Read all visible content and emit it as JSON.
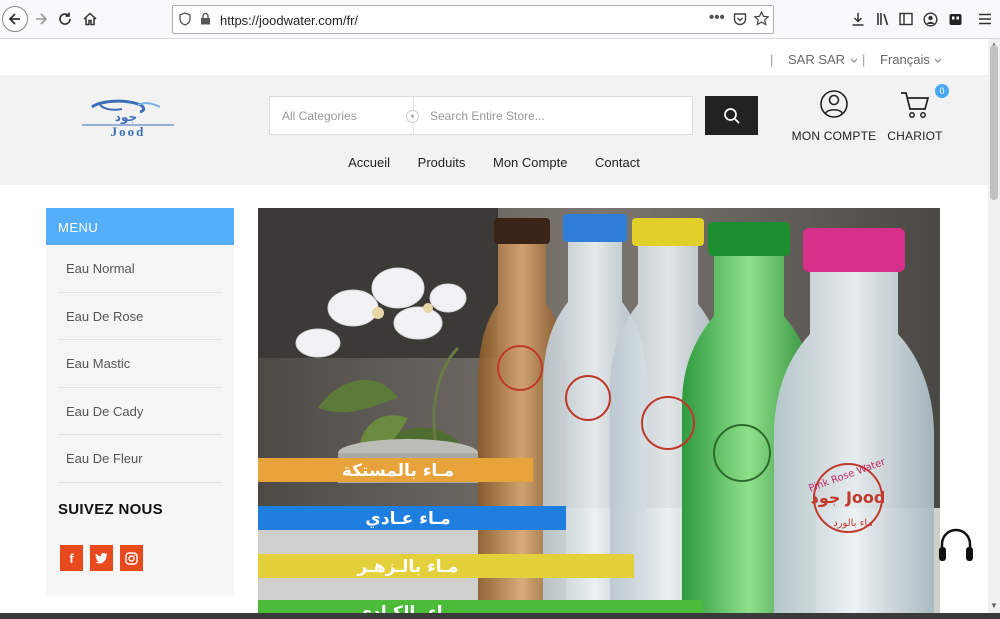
{
  "browser": {
    "url": "https://joodwater.com/fr/"
  },
  "topbar": {
    "sep1": "|",
    "currency": "SAR SAR",
    "sep2": "|",
    "language": "Français"
  },
  "header": {
    "logo_text": "جود Jood",
    "category_select": "All Categories",
    "search_placeholder": "Search Entire Store...",
    "account_label": "MON COMPTE",
    "cart_label": "CHARIOT",
    "cart_count": "0"
  },
  "nav": {
    "items": [
      "Accueil",
      "Produits",
      "Mon Compte",
      "Contact"
    ]
  },
  "sidebar": {
    "title": "MENU",
    "items": [
      "Eau Normal",
      "Eau De Rose",
      "Eau Mastic",
      "Eau De Cady",
      "Eau De Fleur"
    ],
    "follow_title": "SUIVEZ NOUS",
    "social": [
      {
        "name": "facebook-icon",
        "glyph": "f"
      },
      {
        "name": "twitter-icon",
        "glyph": "t"
      },
      {
        "name": "instagram-icon",
        "glyph": "◎"
      }
    ]
  },
  "banner": {
    "labels": [
      "مـاء بالمستكة",
      "مـاء عـادي",
      "مـاء بالـزهـر",
      "مـاء بالكـادي"
    ],
    "bottle_label": "Pink Rose Water",
    "bottle_label_ar": "ماء بالورد",
    "bottle_brand": "جود Jood",
    "label_colors": [
      "#e8a23a",
      "#1e7fe0",
      "#e4d03a",
      "#4cbb3a"
    ]
  }
}
